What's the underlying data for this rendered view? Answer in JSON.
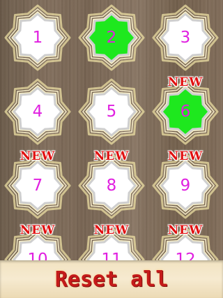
{
  "levels": [
    {
      "number": "1",
      "status": "locked",
      "badge": ""
    },
    {
      "number": "2",
      "status": "current",
      "badge": ""
    },
    {
      "number": "3",
      "status": "locked",
      "badge": ""
    },
    {
      "number": "4",
      "status": "locked",
      "badge": ""
    },
    {
      "number": "5",
      "status": "locked",
      "badge": ""
    },
    {
      "number": "6",
      "status": "current",
      "badge": "NEW"
    },
    {
      "number": "7",
      "status": "locked",
      "badge": "NEW"
    },
    {
      "number": "8",
      "status": "locked",
      "badge": "NEW"
    },
    {
      "number": "9",
      "status": "locked",
      "badge": "NEW"
    },
    {
      "number": "10",
      "status": "locked",
      "badge": "NEW"
    },
    {
      "number": "11",
      "status": "locked",
      "badge": "NEW"
    },
    {
      "number": "12",
      "status": "locked",
      "badge": "NEW"
    }
  ],
  "footer": {
    "reset_label": "Reset all"
  },
  "colors": {
    "number": "#e020e0",
    "badge": "#e01010",
    "green": "#1ee81e",
    "white": "#ffffff",
    "glow": "#f3e7a8"
  }
}
